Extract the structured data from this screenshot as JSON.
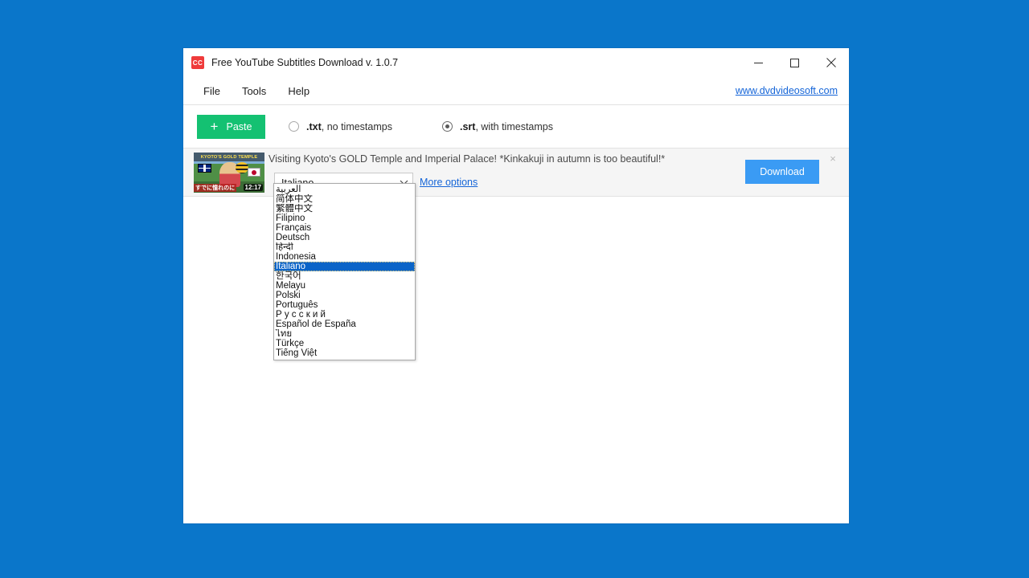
{
  "desktop": {
    "background_color": "#0a76ca"
  },
  "window": {
    "title": "Free YouTube Subtitles Download v. 1.0.7",
    "icon": "cc-icon",
    "icon_label": "CC",
    "controls": {
      "minimize": "minimize-icon",
      "maximize": "maximize-icon",
      "close": "close-icon"
    }
  },
  "menubar": {
    "items": [
      {
        "label": "File"
      },
      {
        "label": "Tools"
      },
      {
        "label": "Help"
      }
    ],
    "site_link": "www.dvdvideosoft.com"
  },
  "toolbar": {
    "paste_label": "Paste",
    "paste_plus": "+",
    "paste_color": "#14c172",
    "format_options": [
      {
        "ext": ".txt",
        "rest": ", no timestamps",
        "checked": false
      },
      {
        "ext": ".srt",
        "rest": ", with timestamps",
        "checked": true
      }
    ]
  },
  "video_item": {
    "title": "Visiting Kyoto's GOLD Temple and Imperial Palace! *Kinkakuji in autumn is too beautiful!*",
    "thumbnail": {
      "overlay_title": "KYOTO'S GOLD TEMPLE",
      "caption": "すでに憧れのに",
      "duration": "12:17"
    },
    "language_selected": "Italiano",
    "more_options_label": "More options",
    "download_label": "Download",
    "download_color": "#3a9bf4",
    "remove_label": "×"
  },
  "language_dropdown": {
    "open": true,
    "selected_index": 8,
    "items": [
      {
        "label": "العربية",
        "rtl": true
      },
      {
        "label": "简体中文",
        "rtl": false
      },
      {
        "label": "繁體中文",
        "rtl": false
      },
      {
        "label": "Filipino",
        "rtl": false
      },
      {
        "label": "Français",
        "rtl": false
      },
      {
        "label": "Deutsch",
        "rtl": false
      },
      {
        "label": "हिन्दी",
        "rtl": false
      },
      {
        "label": "Indonesia",
        "rtl": false
      },
      {
        "label": "Italiano",
        "rtl": false
      },
      {
        "label": "한국어",
        "rtl": false
      },
      {
        "label": "Melayu",
        "rtl": false
      },
      {
        "label": "Polski",
        "rtl": false
      },
      {
        "label": "Português",
        "rtl": false
      },
      {
        "label": "Р у с с к и й",
        "rtl": false
      },
      {
        "label": "Español de España",
        "rtl": false
      },
      {
        "label": "ไทย",
        "rtl": false
      },
      {
        "label": "Türkçe",
        "rtl": false
      },
      {
        "label": "Tiếng Việt",
        "rtl": false
      }
    ]
  }
}
